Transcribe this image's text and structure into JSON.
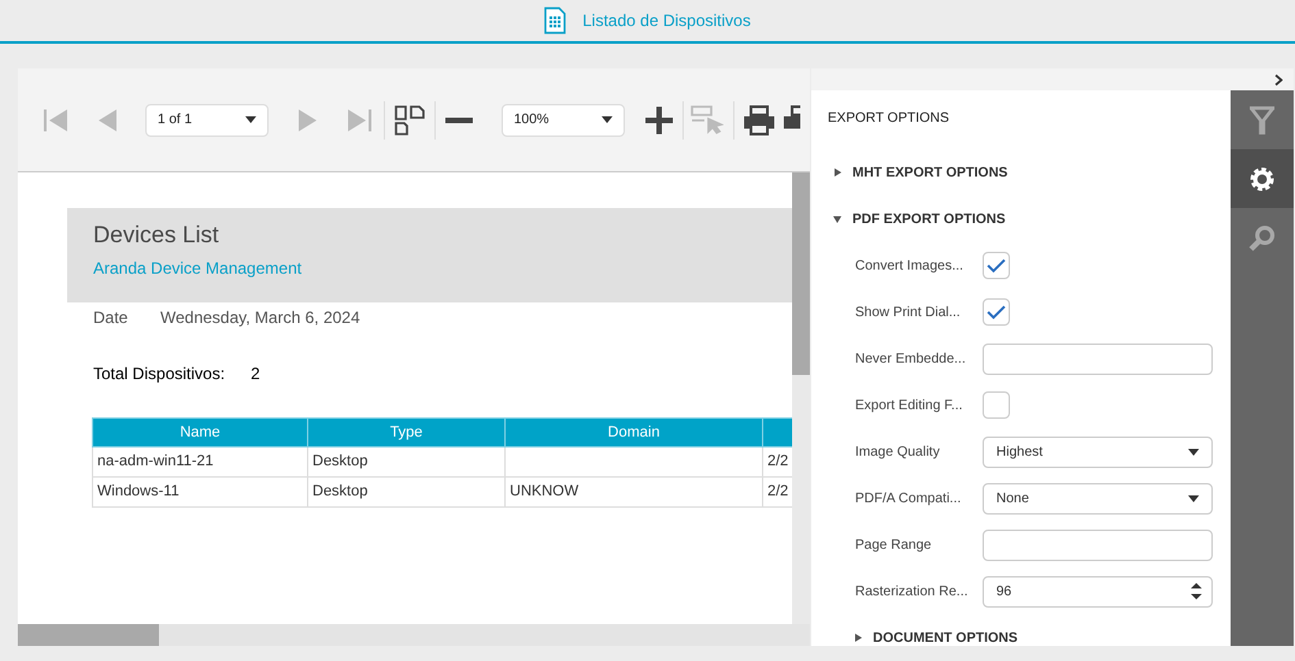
{
  "header": {
    "title": "Listado de Dispositivos"
  },
  "toolbar": {
    "page_selector": "1 of 1",
    "zoom": "100%"
  },
  "report": {
    "title": "Devices List",
    "subtitle": "Aranda Device Management",
    "date_label": "Date",
    "date_value": "Wednesday, March 6, 2024",
    "total_label": "Total Dispositivos:",
    "total_value": "2",
    "table": {
      "columns": [
        "Name",
        "Type",
        "Domain",
        ""
      ],
      "rows": [
        [
          "na-adm-win11-21",
          "Desktop",
          "",
          "2/2"
        ],
        [
          "Windows-11",
          "Desktop",
          "UNKNOW",
          "2/2"
        ]
      ]
    }
  },
  "panel": {
    "title": "EXPORT OPTIONS",
    "sections": [
      {
        "label": "MHT EXPORT OPTIONS",
        "expanded": false,
        "indent": false
      },
      {
        "label": "PDF EXPORT OPTIONS",
        "expanded": true,
        "indent": false,
        "fields": [
          {
            "kind": "checkbox",
            "label": "Convert Images...",
            "checked": true
          },
          {
            "kind": "checkbox",
            "label": "Show Print Dial...",
            "checked": true
          },
          {
            "kind": "text",
            "label": "Never Embedde..."
          },
          {
            "kind": "checkbox",
            "label": "Export Editing F...",
            "checked": false
          },
          {
            "kind": "select",
            "label": "Image Quality",
            "value": "Highest"
          },
          {
            "kind": "select",
            "label": "PDF/A Compati...",
            "value": "None"
          },
          {
            "kind": "text",
            "label": "Page Range"
          },
          {
            "kind": "spin",
            "label": "Rasterization Re...",
            "value": "96"
          }
        ]
      },
      {
        "label": "DOCUMENT OPTIONS",
        "expanded": false,
        "indent": true
      }
    ]
  },
  "side_tabs": [
    {
      "kind": "filter",
      "selected": false
    },
    {
      "kind": "settings",
      "selected": true
    },
    {
      "kind": "search",
      "selected": false
    }
  ]
}
